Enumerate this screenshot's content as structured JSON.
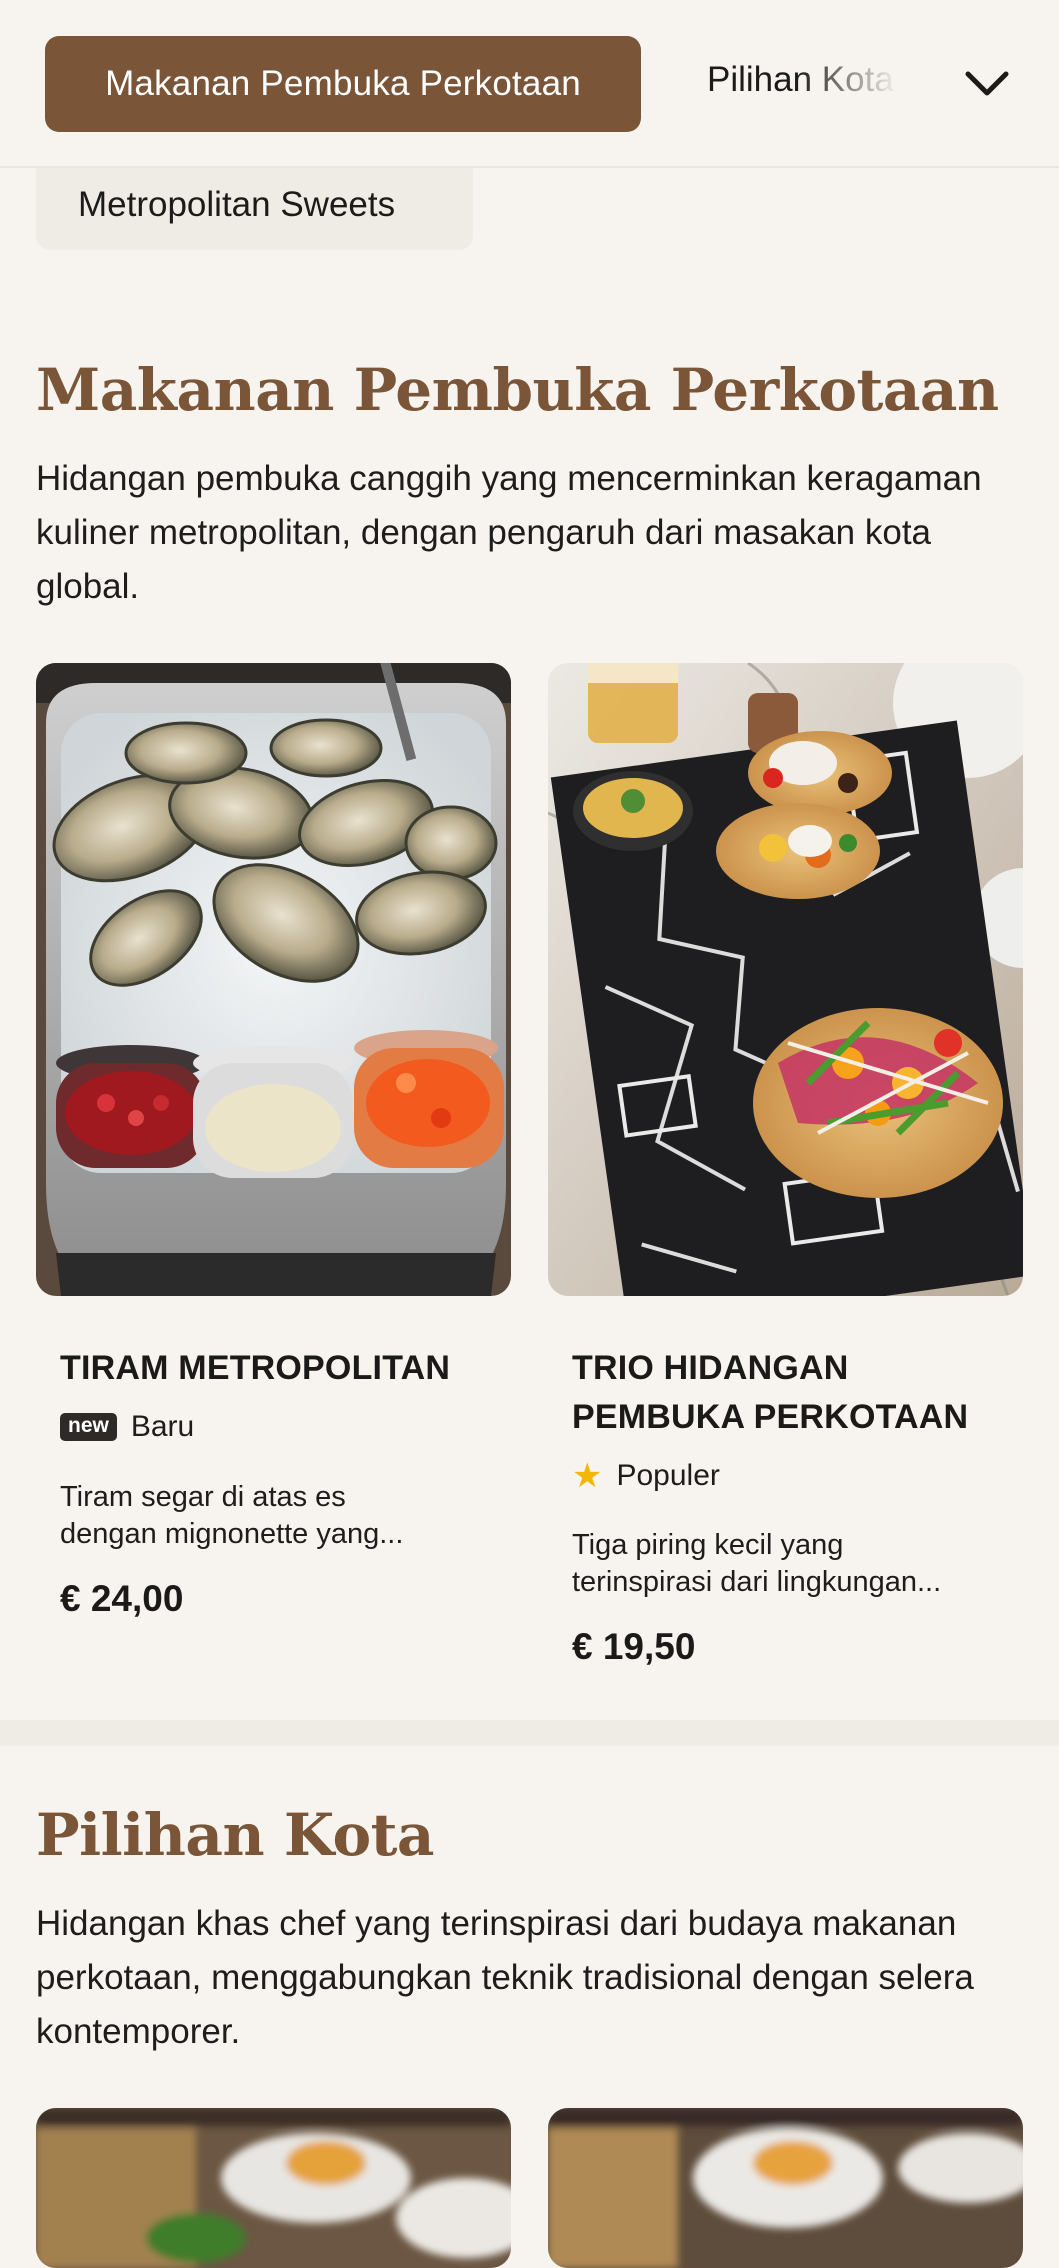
{
  "nav": {
    "active_category": "Makanan Pembuka Perkotaan",
    "next_category": "Pilihan Kota",
    "extra_category": "Metropolitan Sweets"
  },
  "sections": [
    {
      "title": "Makanan Pembuka Perkotaan",
      "description": "Hidangan pembuka canggih yang mencerminkan keragaman kuliner metropolitan, dengan pengaruh dari masakan kota global.",
      "items": [
        {
          "name": "TIRAM METROPOLITAN",
          "badge_tag": "new",
          "badge_label": "Baru",
          "desc_line1": "Tiram segar di atas es",
          "desc_line2": "dengan mignonette yang...",
          "price": "€ 24,00"
        },
        {
          "name": "TRIO HIDANGAN PEMBUKA PERKOTAAN",
          "badge_icon": "star-icon",
          "badge_label": "Populer",
          "desc_line1": "Tiga piring kecil yang",
          "desc_line2": "terinspirasi dari lingkungan...",
          "price": "€ 19,50"
        }
      ]
    },
    {
      "title": "Pilihan Kota",
      "description": "Hidangan khas chef yang terinspirasi dari budaya makanan perkotaan, menggabungkan teknik tradisional dengan selera kontemporer."
    }
  ],
  "colors": {
    "accent": "#7a5538",
    "background": "#f7f4ef",
    "star": "#f2b705"
  }
}
